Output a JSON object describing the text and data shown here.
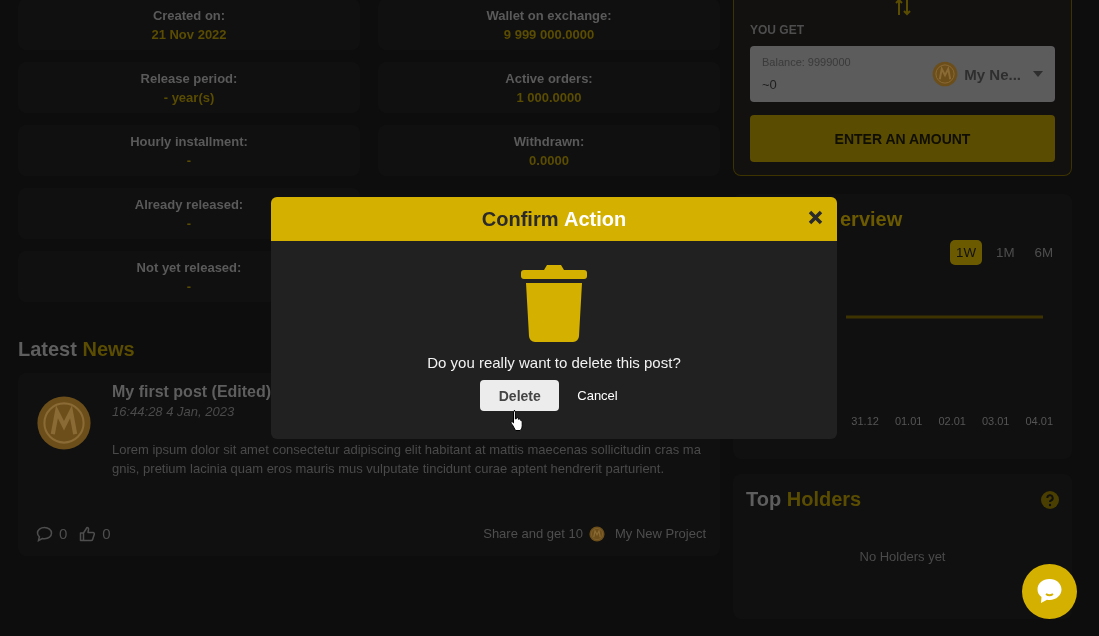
{
  "stats": [
    {
      "label": "Created on:",
      "value": "21 Nov 2022"
    },
    {
      "label": "Wallet on exchange:",
      "value": "9 999 000.0000"
    },
    {
      "label": "Release period:",
      "value": "- year(s)"
    },
    {
      "label": "Active orders:",
      "value": "1 000.0000"
    },
    {
      "label": "Hourly installment:",
      "value": "-"
    },
    {
      "label": "Withdrawn:",
      "value": "0.0000"
    },
    {
      "label": "Already released:",
      "value": "-"
    },
    {
      "label": "Not yet released:",
      "value": "-"
    }
  ],
  "news": {
    "heading": "Latest **News**",
    "post": {
      "title": "My first post (Edited)",
      "time": "16:44:28 4 Jan, 2023",
      "body": "Lorem ipsum dolor sit amet consectetur adipiscing elit habitant at mattis maecenas sollicitudin cras magnis, pretium lacinia quam eros mauris mus vulputate tincidunt curae aptent hendrerit parturient.",
      "comments": "0",
      "likes": "0",
      "share": "Share and get 10",
      "token": "My New Project"
    }
  },
  "swap": {
    "label": "YOU GET",
    "balance": "Balance: 9999000",
    "amount": "~0",
    "token": "My Ne...",
    "button": "ENTER AN AMOUNT"
  },
  "price_chart": {
    "title": "erview",
    "ranges": [
      {
        "label": "1W",
        "selected": true
      },
      {
        "label": "1M",
        "selected": false
      },
      {
        "label": "6M",
        "selected": false
      }
    ],
    "x_labels": [
      "31.12",
      "01.01",
      "02.01",
      "03.01",
      "04.01"
    ]
  },
  "holders": {
    "title": "Top **Holders**",
    "empty": "No Holders yet"
  },
  "modal": {
    "title": "Confirm **Action**",
    "message": "Do you really want to delete this post?",
    "confirm": "Delete",
    "cancel": "Cancel"
  }
}
